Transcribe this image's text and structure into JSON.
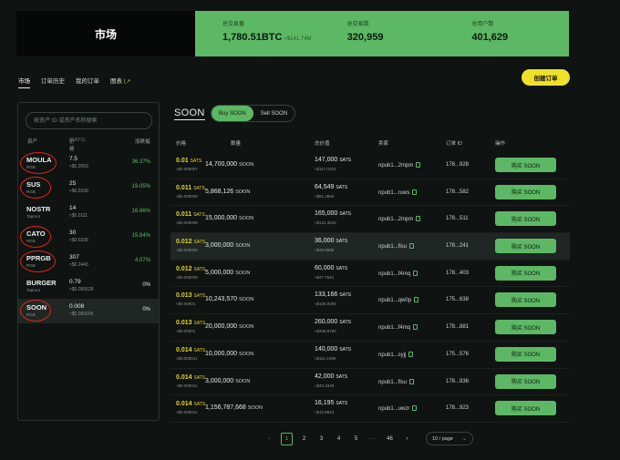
{
  "hero": {
    "title": "市场"
  },
  "stats": [
    {
      "label": "总交易量",
      "value": "1,780.51BTC",
      "sub": "≈$141.74M"
    },
    {
      "label": "总交易数",
      "value": "320,959",
      "sub": ""
    },
    {
      "label": "总用户数",
      "value": "401,629",
      "sub": ""
    }
  ],
  "tabs": [
    {
      "label": "市场",
      "active": true
    },
    {
      "label": "订单历史",
      "active": false
    },
    {
      "label": "我的订单",
      "active": false
    },
    {
      "label": "图表",
      "active": false,
      "icon": "chart-icon"
    }
  ],
  "create_order_label": "创建订单",
  "search": {
    "placeholder": "按资产 ID 或资产名称搜索",
    "value": ""
  },
  "asset_header": {
    "asset": "资产",
    "price": "价格",
    "price_unit": "(SATS)",
    "change": "涨跌幅"
  },
  "assets": [
    {
      "name": "MOULA",
      "tag": "RGB",
      "price": "7.5",
      "usd": "≈$0.0059",
      "change": "36.37%",
      "circled": true
    },
    {
      "name": "SUS",
      "tag": "RGB",
      "price": "25",
      "usd": "≈$0.0199",
      "change": "19.05%",
      "circled": true
    },
    {
      "name": "NOSTR",
      "tag": "Taproot",
      "price": "14",
      "usd": "≈$0.0111",
      "change": "16.66%",
      "circled": false
    },
    {
      "name": "CATO",
      "tag": "RGB",
      "price": "30",
      "usd": "≈$0.0238",
      "change": "15.84%",
      "circled": true
    },
    {
      "name": "PPRGB",
      "tag": "RGB",
      "price": "307",
      "usd": "≈$0.2443",
      "change": "4.07%",
      "circled": true
    },
    {
      "name": "BURGER",
      "tag": "Taproot",
      "price": "0.79",
      "usd": "≈$0.000628",
      "change": "0%",
      "circled": false
    },
    {
      "name": "SOON",
      "tag": "RGB",
      "price": "0.008",
      "usd": "≈$0.000006",
      "change": "0%",
      "circled": true,
      "selected": true
    }
  ],
  "market": {
    "title": "SOON",
    "buy_label": "Buy SOON",
    "sell_label": "Sell SOON",
    "columns": {
      "price": "价格",
      "qty": "数量",
      "total": "总价值",
      "seller": "卖家",
      "order_id": "订单 ID",
      "action": "操作"
    },
    "buy_button_label": "购买 SOON",
    "unit_sats": "SATS",
    "unit_soon": "SOON"
  },
  "orders": [
    {
      "price": "0.01",
      "price_usd": "≈$0.000007",
      "qty": "14,700,000",
      "total": "147,000",
      "total_usd": "≈$117.0222",
      "seller": "npub1...2mpm",
      "order_id": "178...928"
    },
    {
      "price": "0.011",
      "price_usd": "≈$0.000008",
      "qty": "5,868,126",
      "total": "64,549",
      "total_usd": "≈$51.3855",
      "seller": "npub1...ruws",
      "order_id": "178...582"
    },
    {
      "price": "0.011",
      "price_usd": "≈$0.000008",
      "qty": "15,000,000",
      "total": "165,000",
      "total_usd": "≈$131.3515",
      "seller": "npub1...2mpm",
      "order_id": "178...511"
    },
    {
      "price": "0.012",
      "price_usd": "≈$0.000009",
      "qty": "3,000,000",
      "total": "36,000",
      "total_usd": "≈$28.6585",
      "seller": "npub1...flsu",
      "order_id": "178...241",
      "highlight": true
    },
    {
      "price": "0.012",
      "price_usd": "≈$0.000009",
      "qty": "5,000,000",
      "total": "60,000",
      "total_usd": "≈$47.7641",
      "seller": "npub1...f4mq",
      "order_id": "178...403"
    },
    {
      "price": "0.013",
      "price_usd": "≈$0.00001",
      "qty": "10,243,570",
      "total": "133,166",
      "total_usd": "≈$106.0094",
      "seller": "npub1...qw0p",
      "order_id": "175...638"
    },
    {
      "price": "0.013",
      "price_usd": "≈$0.00001",
      "qty": "20,000,000",
      "total": "260,000",
      "total_usd": "≈$206.9782",
      "seller": "npub1...f4mq",
      "order_id": "178...881"
    },
    {
      "price": "0.014",
      "price_usd": "≈$0.000011",
      "qty": "10,000,000",
      "total": "140,000",
      "total_usd": "≈$111.4498",
      "seller": "npub1...syjj",
      "order_id": "175...576"
    },
    {
      "price": "0.014",
      "price_usd": "≈$0.000011",
      "qty": "3,000,000",
      "total": "42,000",
      "total_usd": "≈$33.4349",
      "seller": "npub1...flsu",
      "order_id": "178...936"
    },
    {
      "price": "0.014",
      "price_usd": "≈$0.000011",
      "qty": "1,156,787,668",
      "total": "16,195",
      "total_usd": "≈$12.8923",
      "seller": "npub1...uwzr",
      "order_id": "178...923"
    }
  ],
  "pagination": {
    "pages": [
      "1",
      "2",
      "3",
      "4",
      "5"
    ],
    "active": "1",
    "ellipsis": "···",
    "last": "46",
    "page_size": "10 / page",
    "prev_icon": "chevron-left-icon",
    "next_icon": "chevron-right-icon"
  },
  "colors": {
    "accent": "#5db865",
    "yellow": "#efe12a",
    "price": "#e3d42a",
    "annotation": "#e0241f",
    "background": "#0f1311"
  }
}
